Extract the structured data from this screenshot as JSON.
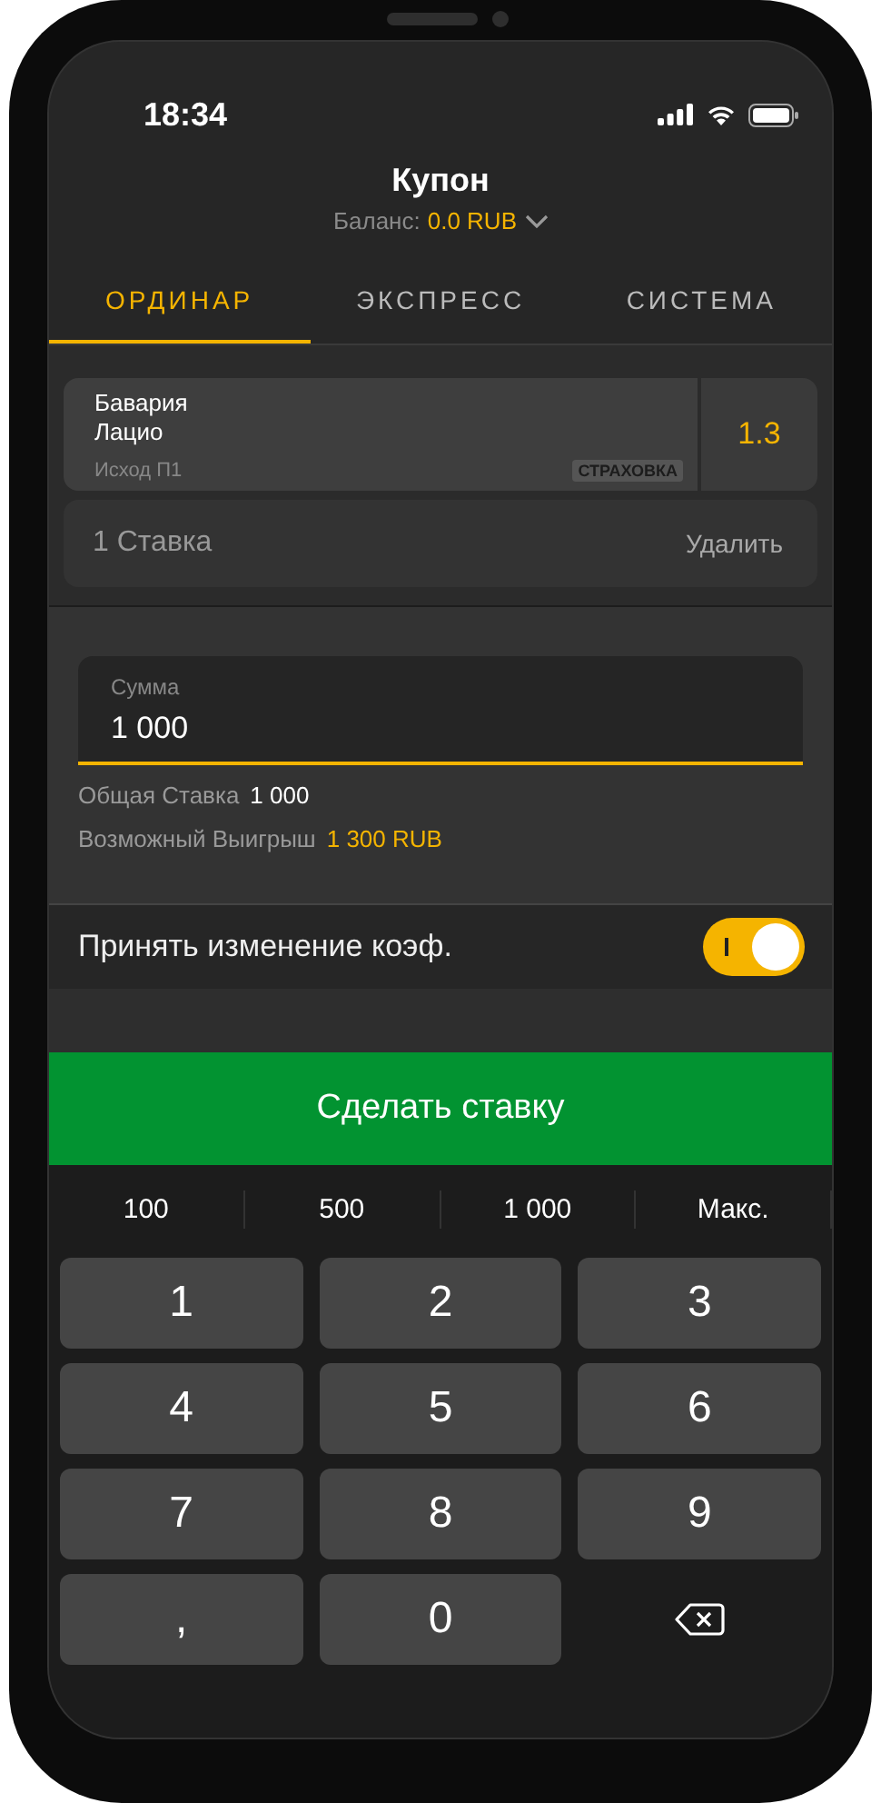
{
  "status_bar": {
    "time": "18:34"
  },
  "header": {
    "title": "Купон",
    "balance_label": "Баланс:",
    "balance_value": "0.0 RUB"
  },
  "tabs": [
    {
      "label": "ОРДИНАР",
      "selected": true
    },
    {
      "label": "ЭКСПРЕСС",
      "selected": false
    },
    {
      "label": "СИСТЕМА",
      "selected": false
    }
  ],
  "bet": {
    "team_1": "Бавария",
    "team_2": "Лацио",
    "outcome": "Исход П1",
    "badge": "СТРАХОВКА",
    "odds": "1.3"
  },
  "stake_row": {
    "count": "1 Ставка",
    "delete": "Удалить"
  },
  "amount_field": {
    "label": "Сумма",
    "value": "1 000"
  },
  "summary": [
    {
      "label": "Общая Ставка",
      "value": "1 000",
      "kind": "plain"
    },
    {
      "label": "Возможный Выигрыш",
      "value": "1 300 RUB",
      "kind": "accent"
    }
  ],
  "accept_toggle": {
    "label": "Принять изменение коэф.",
    "on": true
  },
  "place_bet_button": "Сделать ставку",
  "quick_amounts": [
    "100",
    "500",
    "1 000",
    "Макс."
  ],
  "keypad": [
    {
      "label": "1",
      "kind": "key"
    },
    {
      "label": "2",
      "kind": "key"
    },
    {
      "label": "3",
      "kind": "key"
    },
    {
      "label": "4",
      "kind": "key"
    },
    {
      "label": "5",
      "kind": "key"
    },
    {
      "label": "6",
      "kind": "key"
    },
    {
      "label": "7",
      "kind": "key"
    },
    {
      "label": "8",
      "kind": "key"
    },
    {
      "label": "9",
      "kind": "key"
    },
    {
      "label": ",",
      "kind": "key"
    },
    {
      "label": "0",
      "kind": "key"
    },
    {
      "kind": "backspace"
    }
  ]
}
